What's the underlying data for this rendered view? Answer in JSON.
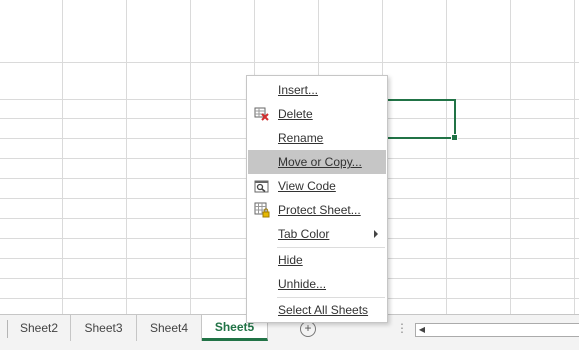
{
  "sheet_tabs": [
    {
      "label": "Sheet2",
      "active": false
    },
    {
      "label": "Sheet3",
      "active": false
    },
    {
      "label": "Sheet4",
      "active": false
    },
    {
      "label": "Sheet5",
      "active": true
    }
  ],
  "add_sheet_icon": "plus-circle-icon",
  "tabbar_more_glyph": "⋮",
  "scroll_left_glyph": "◀",
  "context_menu": {
    "items": [
      {
        "label": "Insert...",
        "icon": "",
        "highlighted": false
      },
      {
        "label": "Delete",
        "icon": "delete-sheet-icon",
        "highlighted": false
      },
      {
        "label": "Rename",
        "icon": "",
        "highlighted": false
      },
      {
        "label": "Move or Copy...",
        "icon": "",
        "highlighted": true
      },
      {
        "label": "View Code",
        "icon": "view-code-icon",
        "highlighted": false
      },
      {
        "label": "Protect Sheet...",
        "icon": "protect-sheet-icon",
        "highlighted": false
      },
      {
        "label": "Tab Color",
        "icon": "",
        "highlighted": false,
        "submenu": true
      },
      {
        "label": "Hide",
        "icon": "",
        "highlighted": false
      },
      {
        "label": "Unhide...",
        "icon": "",
        "highlighted": false
      },
      {
        "label": "Select All Sheets",
        "icon": "",
        "highlighted": false
      }
    ]
  },
  "colors": {
    "accent": "#217346",
    "highlight": "#c6c6c6"
  }
}
